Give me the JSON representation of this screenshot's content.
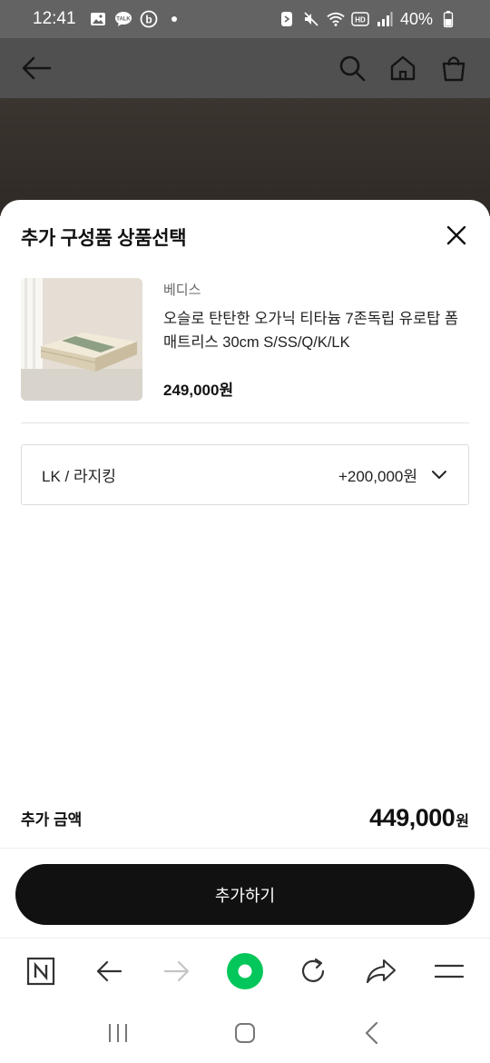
{
  "status_bar": {
    "time": "12:41",
    "battery": "40%",
    "icons_left": [
      "gallery-icon",
      "talk-icon",
      "b-app-icon",
      "dot-icon"
    ],
    "icons_right": [
      "app-icon",
      "mute-icon",
      "wifi-icon",
      "hd-icon",
      "signal-icon",
      "battery-icon"
    ]
  },
  "header": {
    "icons": [
      "back-arrow-icon",
      "search-icon",
      "home-icon",
      "shopping-bag-icon"
    ]
  },
  "sheet": {
    "title": "추가 구성품 상품선택",
    "product": {
      "brand": "베디스",
      "name": "오슬로 탄탄한 오가닉 티타늄 7존독립 유로탑 폼매트리스 30cm S/SS/Q/K/LK",
      "price": "249,000원"
    },
    "option": {
      "label": "LK / 라지킹",
      "price": "+200,000원"
    },
    "total": {
      "label": "추가 금액",
      "value": "449,000",
      "unit": "원"
    },
    "add_button_label": "추가하기"
  },
  "browser_bar": {
    "icons": [
      "naver-n-icon",
      "back-icon",
      "forward-icon",
      "green-dot-icon",
      "refresh-icon",
      "share-icon",
      "menu-icon"
    ],
    "accent_color": "#03c75a"
  },
  "system_nav": {
    "icons": [
      "recent-apps-icon",
      "home-icon",
      "back-icon"
    ]
  }
}
